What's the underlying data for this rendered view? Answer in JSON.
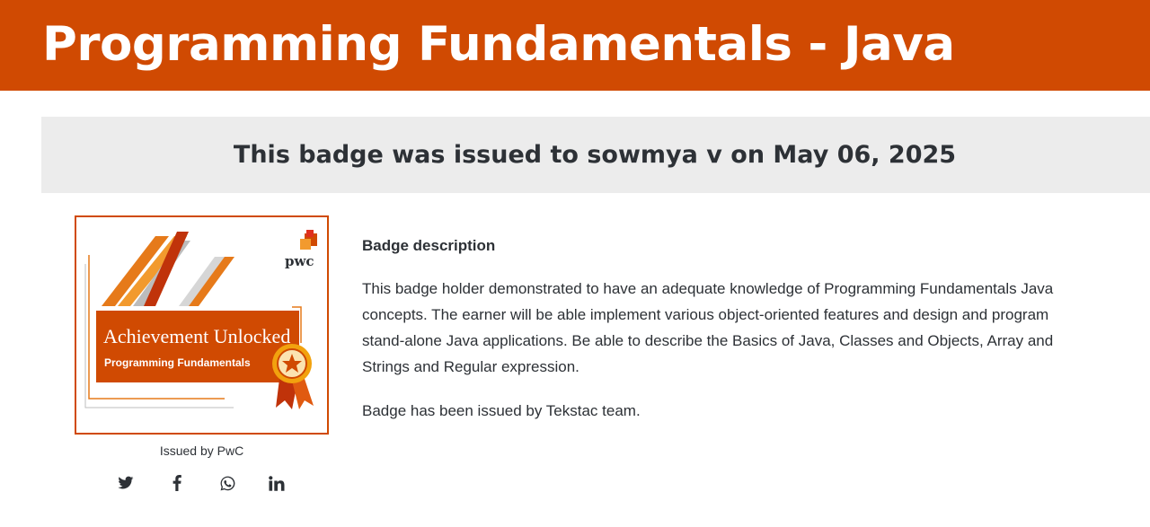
{
  "header": {
    "title": "Programming Fundamentals - Java"
  },
  "issued_banner": {
    "text": "This badge was issued to sowmya v on May 06, 2025"
  },
  "badge_image": {
    "brand": "pwc",
    "headline": "Achievement Unlocked",
    "subtitle": "Programming Fundamentals"
  },
  "issuer": {
    "text": "Issued by PwC"
  },
  "share": {
    "icons": [
      "twitter-icon",
      "facebook-icon",
      "whatsapp-icon",
      "linkedin-icon"
    ]
  },
  "description": {
    "heading": "Badge description",
    "lines": [
      "This badge holder demonstrated to have an adequate knowledge of Programming Fundamentals Java",
      "concepts. The earner will be able implement various object-oriented features and design and program",
      "stand-alone Java applications. Be able to describe the Basics of Java, Classes and Objects, Array and",
      "Strings and Regular expression."
    ],
    "issued_note": "Badge has been issued by Tekstac team."
  },
  "colors": {
    "brand": "#d04a02",
    "banner_bg": "#ececec",
    "text": "#2d3136"
  }
}
